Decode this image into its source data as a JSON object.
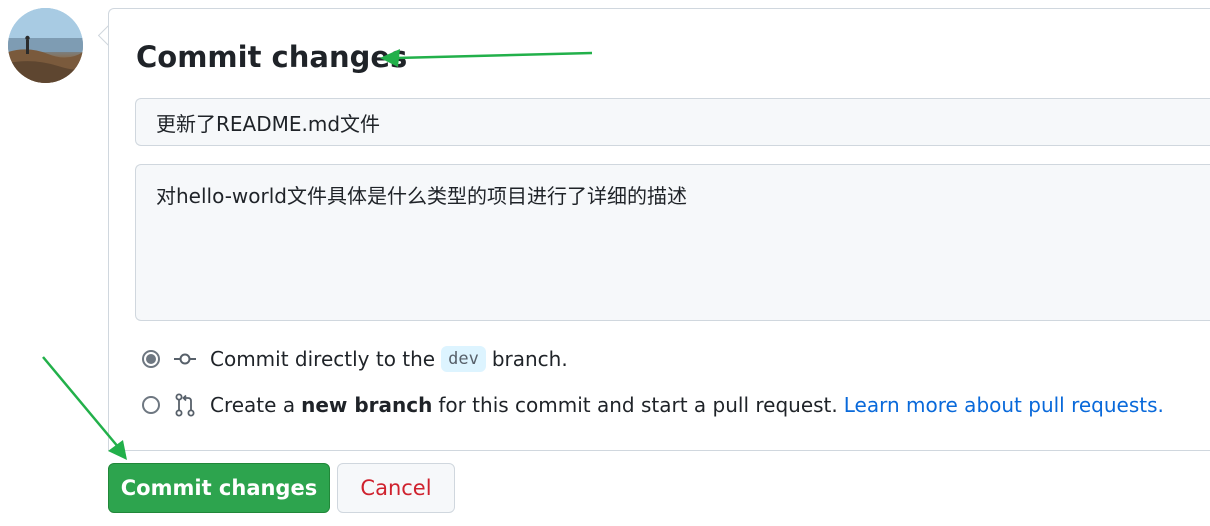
{
  "commit_form": {
    "title": "Commit changes",
    "summary_value": "更新了README.md文件",
    "description_value": "对hello-world文件具体是什么类型的项目进行了详细的描述",
    "options": {
      "direct": {
        "prefix": "Commit directly to the",
        "branch": "dev",
        "suffix": "branch.",
        "selected": true
      },
      "new_branch": {
        "prefix": "Create a",
        "bold": "new branch",
        "suffix": "for this commit and start a pull request.",
        "link": "Learn more about pull requests.",
        "selected": false
      }
    },
    "buttons": {
      "commit": "Commit changes",
      "cancel": "Cancel"
    }
  },
  "icons": {
    "direct_commit": "git-commit-icon",
    "new_branch": "git-pull-request-icon"
  },
  "colors": {
    "primary": "#2da44e",
    "danger": "#cf222e",
    "link": "#0969da",
    "annotation_arrow": "#22b04a"
  }
}
